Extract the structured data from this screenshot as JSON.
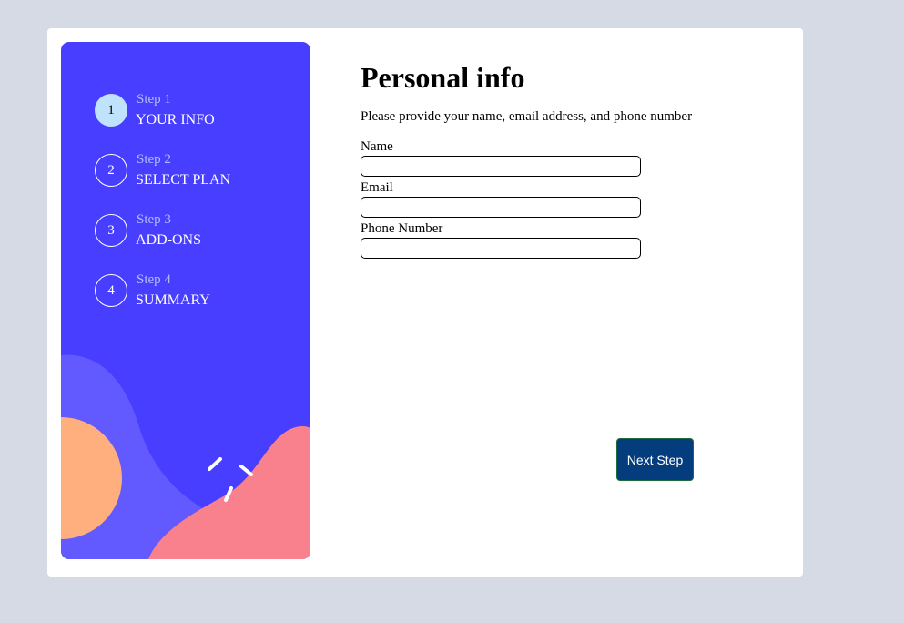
{
  "sidebar": {
    "steps": [
      {
        "number": "1",
        "sub": "Step 1",
        "title": "YOUR INFO",
        "active": true
      },
      {
        "number": "2",
        "sub": "Step 2",
        "title": "SELECT PLAN",
        "active": false
      },
      {
        "number": "3",
        "sub": "Step 3",
        "title": "ADD-ONS",
        "active": false
      },
      {
        "number": "4",
        "sub": "Step 4",
        "title": "SUMMARY",
        "active": false
      }
    ]
  },
  "main": {
    "title": "Personal info",
    "subtitle": "Please provide your name, email address, and phone number",
    "fields": {
      "name": {
        "label": "Name",
        "value": "",
        "placeholder": ""
      },
      "email": {
        "label": "Email",
        "value": "",
        "placeholder": ""
      },
      "phone": {
        "label": "Phone Number",
        "value": "",
        "placeholder": ""
      }
    },
    "next_label": "Next Step"
  },
  "colors": {
    "page_background": "#d6dae5",
    "sidebar_background": "#483eff",
    "active_step": "#bfe2fd",
    "step_sub_text": "#adbeff",
    "next_button": "#043d7e",
    "blob_purple": "#6259ff",
    "blob_orange": "#ffaf7e",
    "blob_pink": "#f9818e"
  }
}
